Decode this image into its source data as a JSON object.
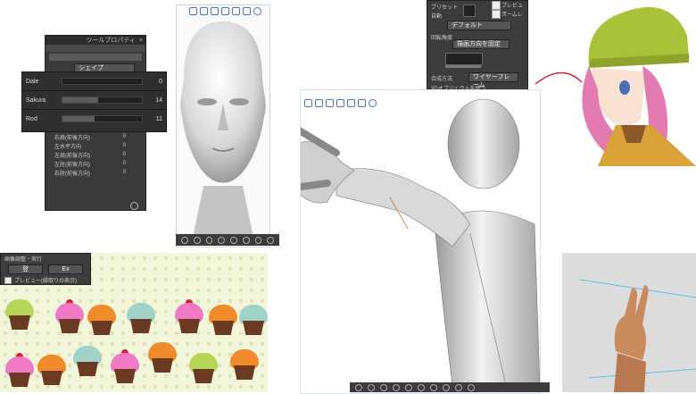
{
  "panel_top_left": {
    "title": "ツールプロパティ",
    "close": "×",
    "dropdown_value": "シェイプ",
    "sliders": [
      {
        "label": "Dale",
        "value": 0,
        "fraction": 0.0
      },
      {
        "label": "Sakura",
        "value": 14,
        "fraction": 0.45
      },
      {
        "label": "Rod",
        "value": 11,
        "fraction": 0.4
      }
    ],
    "params": [
      {
        "label": "右肩(前後方向)",
        "value": "0"
      },
      {
        "label": "左水平方向",
        "value": "0"
      },
      {
        "label": "左肩(前後方向)",
        "value": "0"
      },
      {
        "label": "左肘(前後方向)",
        "value": "0"
      },
      {
        "label": "右肘(前後方向)",
        "value": "0"
      }
    ]
  },
  "panel_bottom_left": {
    "header": "画像調整・実行",
    "btn_left": "登",
    "btn_right": "Ex",
    "checkbox_label": "プレビュー(縁取りの表示)"
  },
  "panel_top_center": {
    "label_1": "プリセット",
    "label_2": "自動",
    "dropdown_1": "デフォルト",
    "label_3": "回転角度",
    "dropdown_2": "描画方向を固定",
    "label_4": "合成方法",
    "dropdown_3": "ワイヤーフレーム",
    "check_1": "プレビュー",
    "check_2": "ズームレベル",
    "bottom_check": "3Dオブジェクトを使う"
  },
  "colors": {
    "accent_blue": "#4a74c8",
    "dark_panel": "#3a3a3a",
    "hat_green": "#a8c33a",
    "hair_pink": "#e47bb0",
    "jacket_orange": "#d9a33a"
  }
}
